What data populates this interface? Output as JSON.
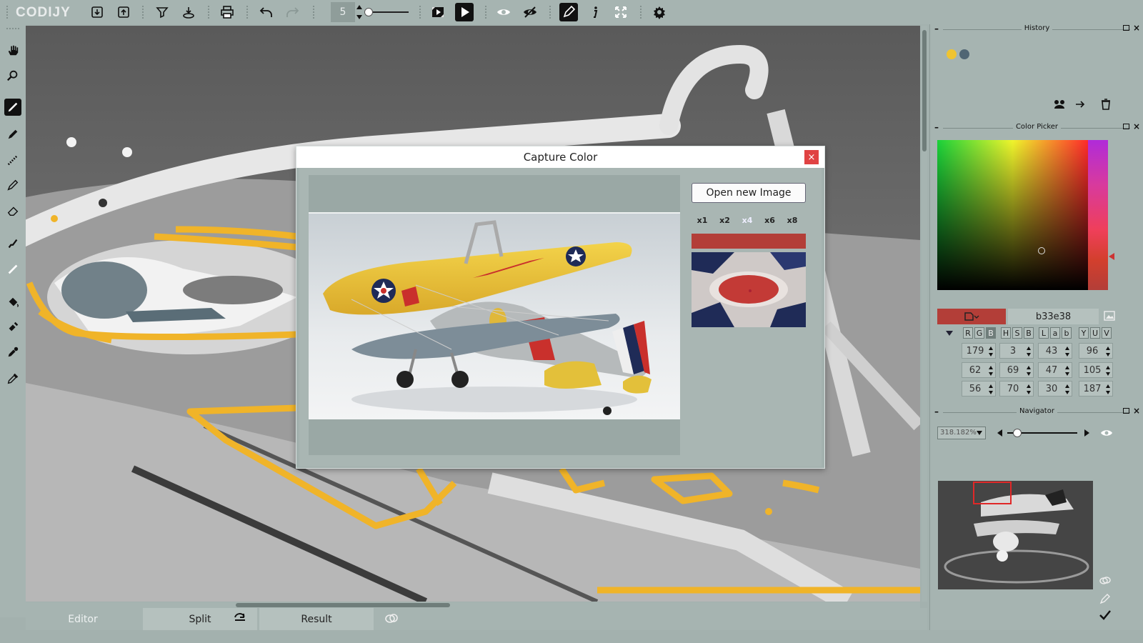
{
  "app": {
    "logo_text": "CODIJY"
  },
  "toolbar": {
    "brush_size": "5",
    "icons": [
      "download-icon",
      "upload-icon",
      "filter-icon",
      "save-stack-icon",
      "print-icon",
      "undo-icon",
      "redo-icon",
      "film-icon",
      "play-icon",
      "eye-icon",
      "eye-crossed-icon",
      "edit-pen-icon",
      "info-icon",
      "fit-icon",
      "settings-icon"
    ]
  },
  "tabs": {
    "editor": "Editor",
    "split": "Split",
    "result": "Result"
  },
  "history": {
    "title": "History",
    "dots": [
      "#f0c431",
      "#506674"
    ]
  },
  "color_picker": {
    "title": "Color Picker",
    "hex": "b33e38",
    "current_color": "#b33e38",
    "channel_groups": [
      [
        "R",
        "G",
        "B"
      ],
      [
        "H",
        "S",
        "B"
      ],
      [
        "L",
        "a",
        "b"
      ],
      [
        "Y",
        "U",
        "V"
      ]
    ],
    "selected_channel": "B",
    "values": [
      [
        "179",
        "3",
        "43",
        "96"
      ],
      [
        "62",
        "69",
        "47",
        "105"
      ],
      [
        "56",
        "70",
        "30",
        "187"
      ]
    ]
  },
  "navigator": {
    "title": "Navigator",
    "zoom": "318.182%",
    "zoom_slider_fraction": 0.14
  },
  "dialog": {
    "title": "Capture Color",
    "close": "×",
    "open_button": "Open new Image",
    "zoom_buttons": [
      "x1",
      "x2",
      "x4",
      "x6",
      "x8"
    ],
    "selected_zoom": "x4",
    "captured_color": "#b33e38"
  }
}
